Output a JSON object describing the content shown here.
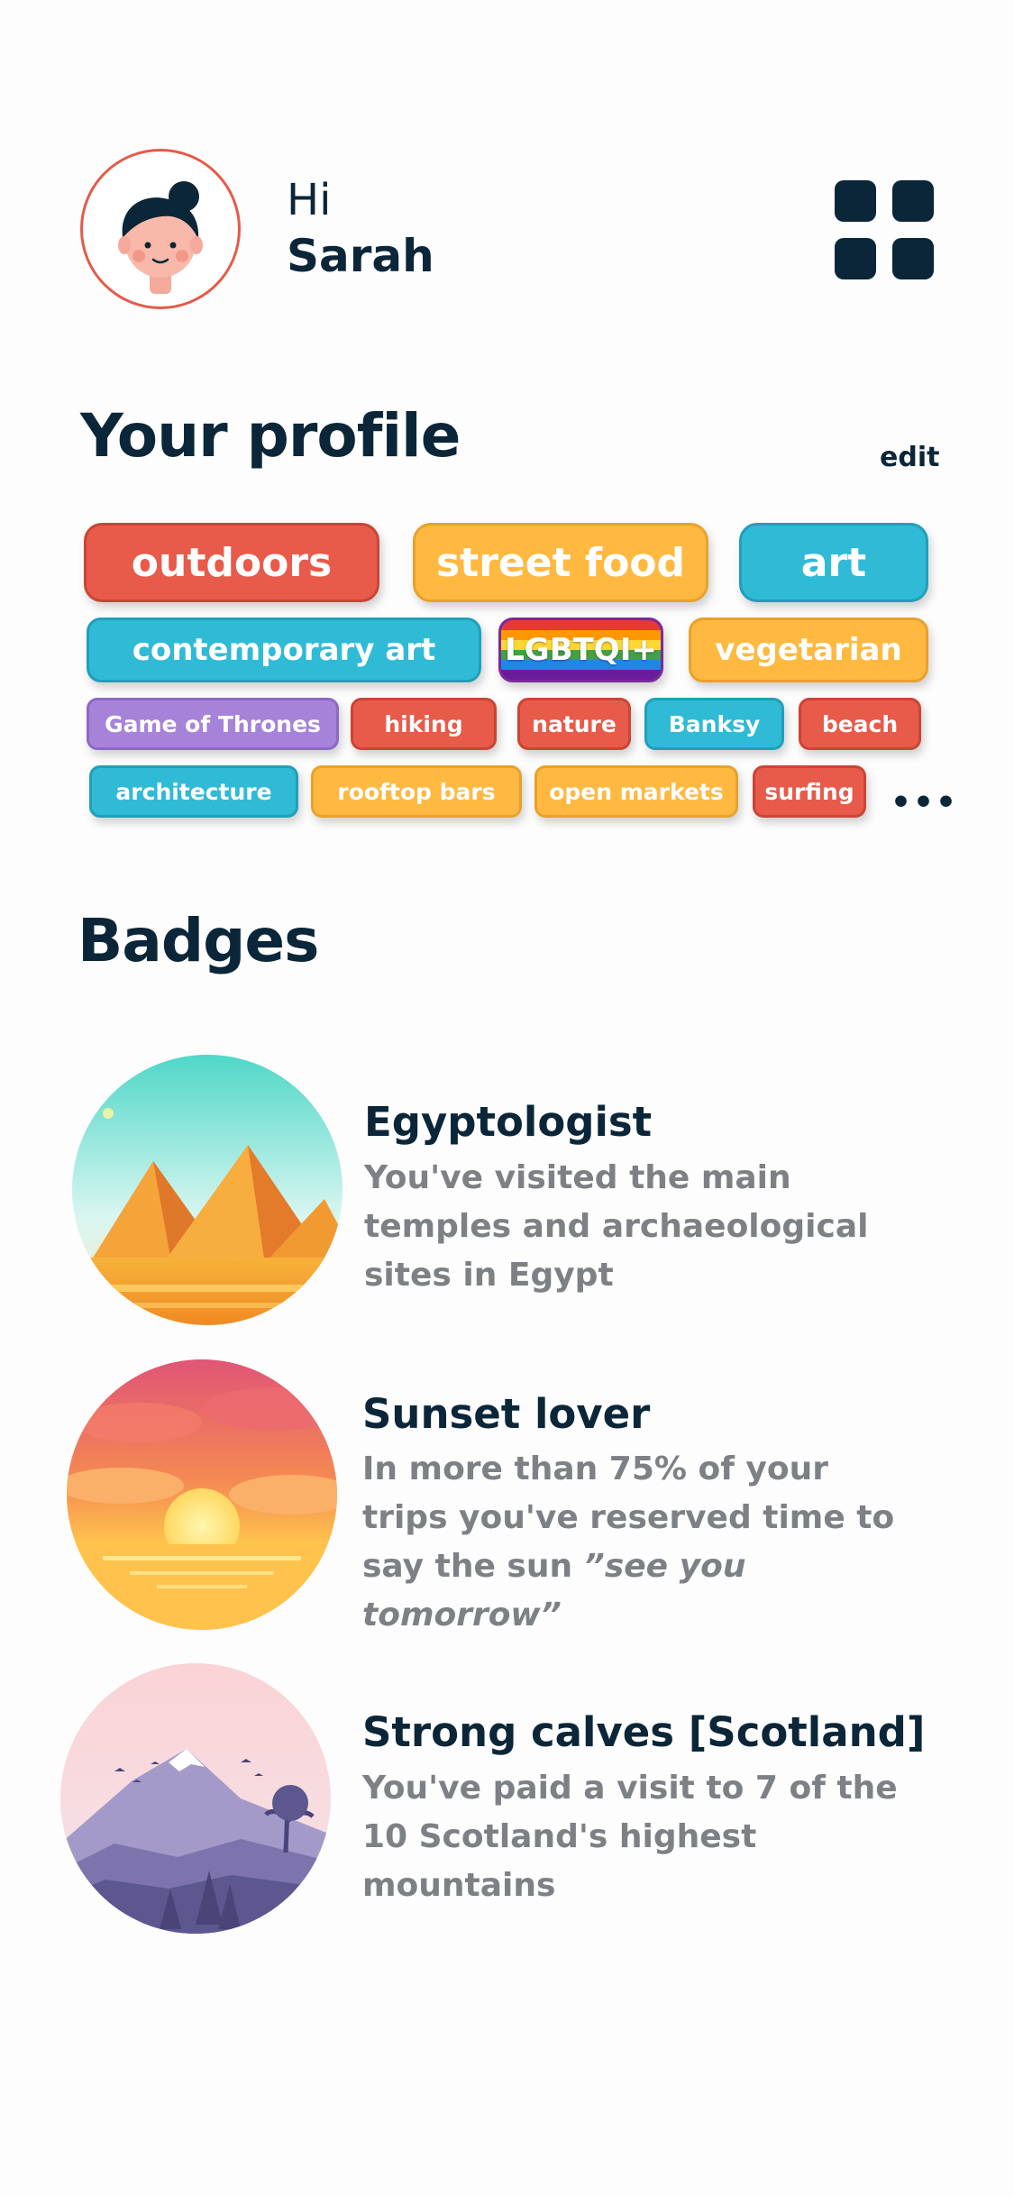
{
  "header": {
    "greeting": "Hi",
    "user_name": "Sarah"
  },
  "profile": {
    "title": "Your profile",
    "edit_label": "edit",
    "more_label": "•••",
    "tags": [
      {
        "label": "outdoors",
        "color": "red"
      },
      {
        "label": "street food",
        "color": "yellow"
      },
      {
        "label": "art",
        "color": "blue"
      },
      {
        "label": "contemporary art",
        "color": "blue"
      },
      {
        "label": "LGBTQI+",
        "color": "rainbow"
      },
      {
        "label": "vegetarian",
        "color": "yellow"
      },
      {
        "label": "Game of Thrones",
        "color": "purple"
      },
      {
        "label": "hiking",
        "color": "red"
      },
      {
        "label": "nature",
        "color": "red"
      },
      {
        "label": "Banksy",
        "color": "blue"
      },
      {
        "label": "beach",
        "color": "red"
      },
      {
        "label": "architecture",
        "color": "blue"
      },
      {
        "label": "rooftop bars",
        "color": "yellow"
      },
      {
        "label": "open markets",
        "color": "yellow"
      },
      {
        "label": "surfing",
        "color": "red"
      }
    ]
  },
  "badges": {
    "title": "Badges",
    "items": [
      {
        "title": "Egyptologist",
        "description": "You've visited the main temples and archaeological sites in Egypt",
        "icon": "pyramids-illustration"
      },
      {
        "title": "Sunset lover",
        "description": "In more than 75% of your trips you've reserved time to say the sun",
        "quote": "”see you tomorrow”",
        "icon": "sunset-illustration"
      },
      {
        "title": "Strong calves [Scotland]",
        "description": "You've paid a visit to 7 of the 10 Scotland's highest mountains",
        "icon": "mountain-illustration"
      }
    ]
  },
  "colors": {
    "primary": "#0b2638",
    "red": "#e85a4a",
    "yellow": "#ffb940",
    "blue": "#2fbad6",
    "purple": "#a683d8",
    "muted_text": "#7d8085"
  }
}
